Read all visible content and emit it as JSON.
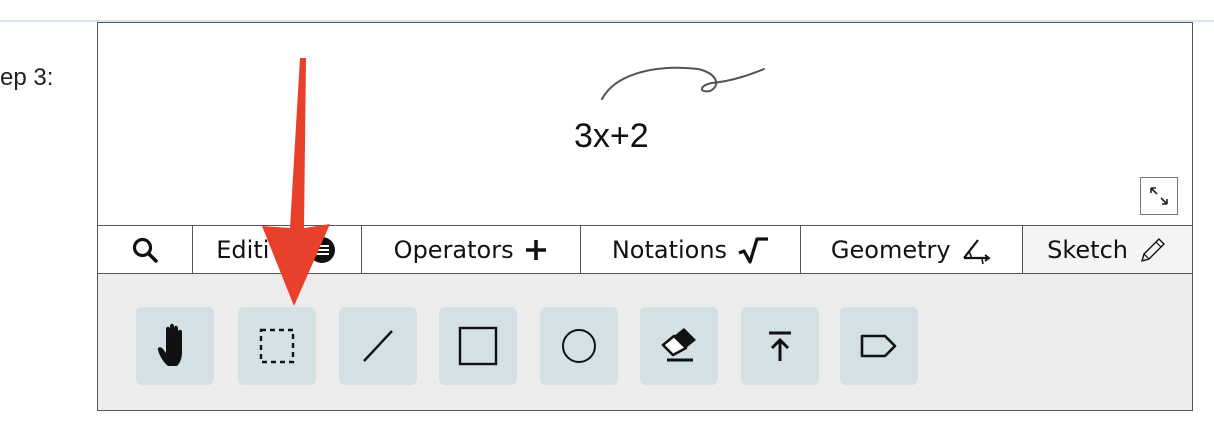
{
  "step_label": "ep 3:",
  "canvas": {
    "expression": "3x+2"
  },
  "tabs": [
    {
      "label": "",
      "icon": "search-icon"
    },
    {
      "label": "Editi",
      "icon": "list-circle-icon"
    },
    {
      "label": "Operators",
      "icon": "plus-icon"
    },
    {
      "label": "Notations",
      "icon": "square-root-icon"
    },
    {
      "label": "Geometry",
      "icon": "angle-icon"
    },
    {
      "label": "Sketch",
      "icon": "pencil-icon",
      "active": true
    }
  ],
  "tools": [
    {
      "icon": "hand-icon"
    },
    {
      "icon": "dashed-selection-icon"
    },
    {
      "icon": "line-icon"
    },
    {
      "icon": "square-icon"
    },
    {
      "icon": "circle-icon"
    },
    {
      "icon": "eraser-icon"
    },
    {
      "icon": "move-to-top-icon"
    },
    {
      "icon": "tag-icon"
    }
  ],
  "colors": {
    "annotation_arrow": "#e8402b",
    "tool_background": "#d3e1e5",
    "toolbox_background": "#ececec",
    "top_rule": "#d4e5f2"
  }
}
